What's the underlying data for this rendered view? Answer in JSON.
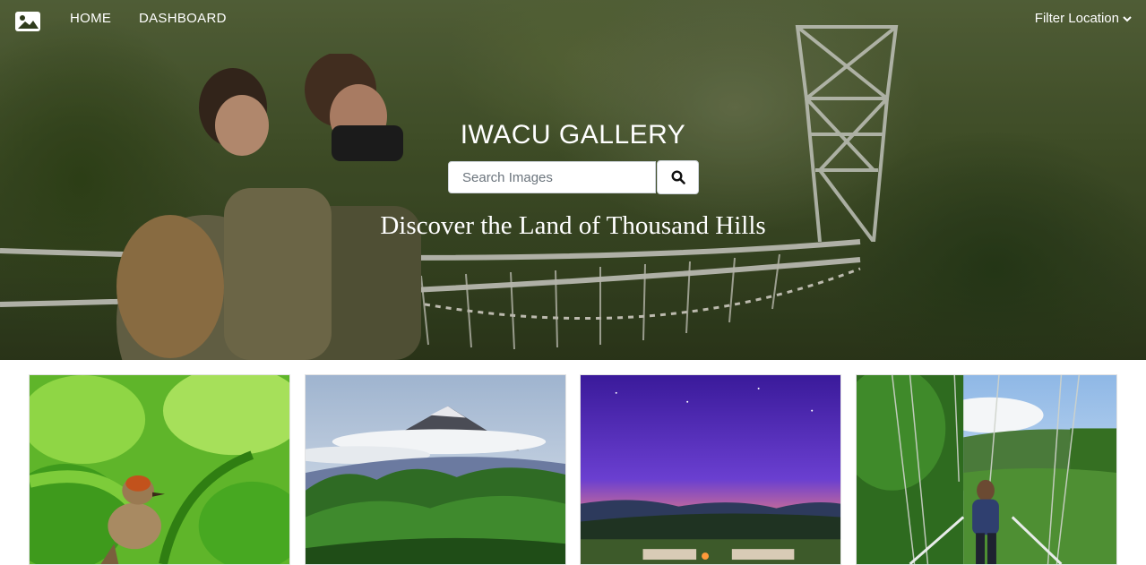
{
  "nav": {
    "home": "HOME",
    "dashboard": "DASHBOARD",
    "filter_location": "Filter Location"
  },
  "hero": {
    "title": "IWACU GALLERY",
    "search_placeholder": "Search Images",
    "tagline": "Discover the Land of Thousand Hills"
  },
  "icons": {
    "logo": "image-icon",
    "search": "search-icon",
    "filter_caret": "chevron-down-icon"
  },
  "gallery": {
    "images": [
      {
        "subject": "bird-in-tea-leaves"
      },
      {
        "subject": "volcano-above-forest"
      },
      {
        "subject": "purple-night-sky-lodge"
      },
      {
        "subject": "man-on-canopy-bridge"
      }
    ]
  },
  "colors": {
    "nav_text": "#ffffff",
    "hero_overlay": "#2f3b1c"
  }
}
